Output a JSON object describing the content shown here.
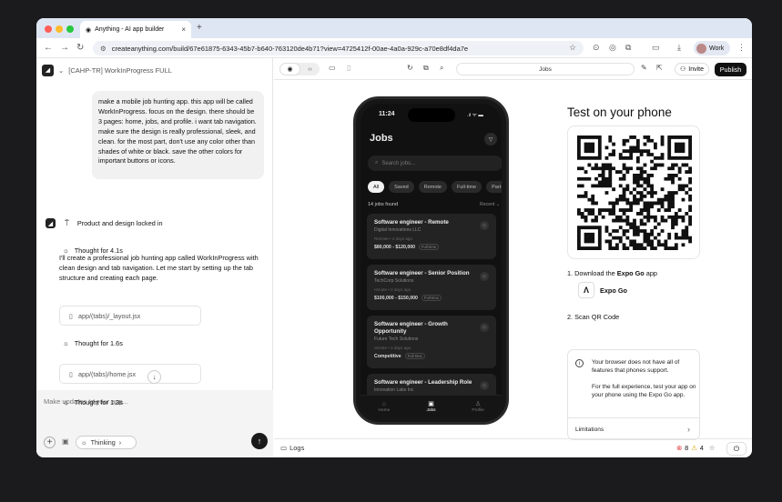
{
  "browser": {
    "tab_title": "Anything - AI app builder",
    "tab_close": "×",
    "new_tab": "+",
    "url": "createanything.com/build/67e61875-6343-45b7-b640-763120de4b71?view=4725412f-00ae-4a0a-929c-a70e8df4da7e",
    "profile": "Work"
  },
  "project": {
    "name": "[CAHP-TR] WorkInProgress FULL"
  },
  "chat": {
    "user_message": "make a mobile job hunting app. this app will be called WorkInProgress. focus on the design. there should be 3 pages: home, jobs, and profile. i want tab navigation. make sure the design is really professional, sleek, and clean. for the most part, don't use any color other than shades of white or black. save the other colors for important buttons or icons.",
    "status": "Product and design locked in",
    "thought1": "Thought for 4.1s",
    "reply": "I'll create a professional job hunting app called WorkInProgress with clean design and tab navigation. Let me start by setting up the tab structure and creating each page.",
    "file1": "app/(tabs)/_layout.jsx",
    "thought2": "Thought for 1.6s",
    "file2": "app/(tabs)/home.jsx",
    "thought3": "Thought for 1.3s"
  },
  "composer": {
    "placeholder": "Make updates to your app...",
    "mode": "Thinking",
    "mode_chevron": "›"
  },
  "toolbar": {
    "route": "Jobs",
    "invite": "Invite",
    "publish": "Publish"
  },
  "app": {
    "time": "11:24",
    "status_icons": ".ıl ᯤ ▬",
    "title": "Jobs",
    "search_placeholder": "Search jobs...",
    "chips": [
      "All",
      "Saved",
      "Remote",
      "Full-time",
      "Part-time"
    ],
    "found": "14 jobs found",
    "sort": "Recent ⌄",
    "jobs": [
      {
        "title": "Software engineer - Remote",
        "company": "Digital Innovations LLC",
        "meta": "Remote  •  2 days ago",
        "salary": "$80,000 - $120,000",
        "type": "Full-time"
      },
      {
        "title": "Software engineer - Senior Position",
        "company": "TechCorp Solutions",
        "meta": "remote  •  2 days ago",
        "salary": "$100,000 - $150,000",
        "type": "Full-time"
      },
      {
        "title": "Software engineer - Growth Opportunity",
        "company": "Future Tech Solutions",
        "meta": "remote  •  2 days ago",
        "salary": "Competitive",
        "type": "Full-time"
      },
      {
        "title": "Software engineer - Leadership Role",
        "company": "Innovation Labs Inc",
        "meta": "",
        "salary": "",
        "type": ""
      }
    ],
    "tabs": [
      "Home",
      "Jobs",
      "Profile"
    ]
  },
  "test": {
    "heading": "Test on your phone",
    "step1_prefix": "1. Download the ",
    "step1_bold": "Expo Go",
    "step1_suffix": " app",
    "expo_label": "Expo Go",
    "step2": "2. Scan QR Code",
    "info1": "Your browser does not have all of features that phones support.",
    "info2": "For the full experience, test your app on your phone using the Expo Go app.",
    "limitations": "Limitations"
  },
  "bottom": {
    "logs": "Logs",
    "errors": "8",
    "warnings": "4"
  },
  "colors": {
    "publish_bg": "#111111",
    "error": "#d9363e",
    "warning": "#d9a400"
  }
}
